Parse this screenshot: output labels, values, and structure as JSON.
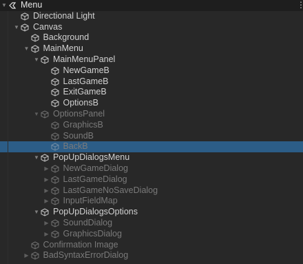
{
  "hierarchy": {
    "items": [
      {
        "label": "Menu",
        "depth": 0,
        "expanded": true,
        "icon": "scene-icon",
        "header": true
      },
      {
        "label": "Directional Light",
        "depth": 1,
        "icon": "gameobject-icon"
      },
      {
        "label": "Canvas",
        "depth": 1,
        "expanded": true,
        "icon": "gameobject-icon"
      },
      {
        "label": "Background",
        "depth": 2,
        "icon": "gameobject-icon"
      },
      {
        "label": "MainMenu",
        "depth": 2,
        "expanded": true,
        "icon": "gameobject-icon"
      },
      {
        "label": "MainMenuPanel",
        "depth": 3,
        "expanded": true,
        "icon": "gameobject-icon"
      },
      {
        "label": "NewGameB",
        "depth": 4,
        "icon": "gameobject-icon"
      },
      {
        "label": "LastGameB",
        "depth": 4,
        "icon": "gameobject-icon"
      },
      {
        "label": "ExitGameB",
        "depth": 4,
        "icon": "gameobject-icon"
      },
      {
        "label": "OptionsB",
        "depth": 4,
        "icon": "gameobject-icon"
      },
      {
        "label": "OptionsPanel",
        "depth": 3,
        "expanded": true,
        "inactive": true,
        "icon": "gameobject-icon"
      },
      {
        "label": "GraphicsB",
        "depth": 4,
        "inactive": true,
        "icon": "gameobject-icon"
      },
      {
        "label": "SoundB",
        "depth": 4,
        "inactive": true,
        "icon": "gameobject-icon"
      },
      {
        "label": "BackB",
        "depth": 4,
        "inactive": true,
        "selected": true,
        "icon": "gameobject-icon"
      },
      {
        "label": "PopUpDialogsMenu",
        "depth": 3,
        "expanded": true,
        "icon": "gameobject-icon"
      },
      {
        "label": "NewGameDialog",
        "depth": 4,
        "collapsed": true,
        "inactive": true,
        "icon": "gameobject-icon"
      },
      {
        "label": "LastGameDialog",
        "depth": 4,
        "collapsed": true,
        "inactive": true,
        "icon": "gameobject-icon"
      },
      {
        "label": "LastGameNoSaveDialog",
        "depth": 4,
        "collapsed": true,
        "inactive": true,
        "icon": "gameobject-icon"
      },
      {
        "label": "InputFieldMap",
        "depth": 4,
        "collapsed": true,
        "inactive": true,
        "icon": "gameobject-icon"
      },
      {
        "label": "PopUpDialogsOptions",
        "depth": 3,
        "expanded": true,
        "icon": "gameobject-icon"
      },
      {
        "label": "SoundDialog",
        "depth": 4,
        "collapsed": true,
        "inactive": true,
        "icon": "gameobject-icon"
      },
      {
        "label": "GraphicsDialog",
        "depth": 4,
        "collapsed": true,
        "inactive": true,
        "icon": "gameobject-icon"
      },
      {
        "label": "Confirmation Image",
        "depth": 2,
        "inactive": true,
        "icon": "gameobject-icon"
      },
      {
        "label": "BadSyntaxErrorDialog",
        "depth": 2,
        "collapsed": true,
        "inactive": true,
        "icon": "gameobject-icon"
      }
    ],
    "menu_icon": "kebab-menu-icon"
  },
  "colors": {
    "background": "#282828",
    "header": "#1e1e1e",
    "selection": "#2c5d87",
    "text": "#d2d2d2",
    "inactive_text": "#7a7a7a"
  }
}
